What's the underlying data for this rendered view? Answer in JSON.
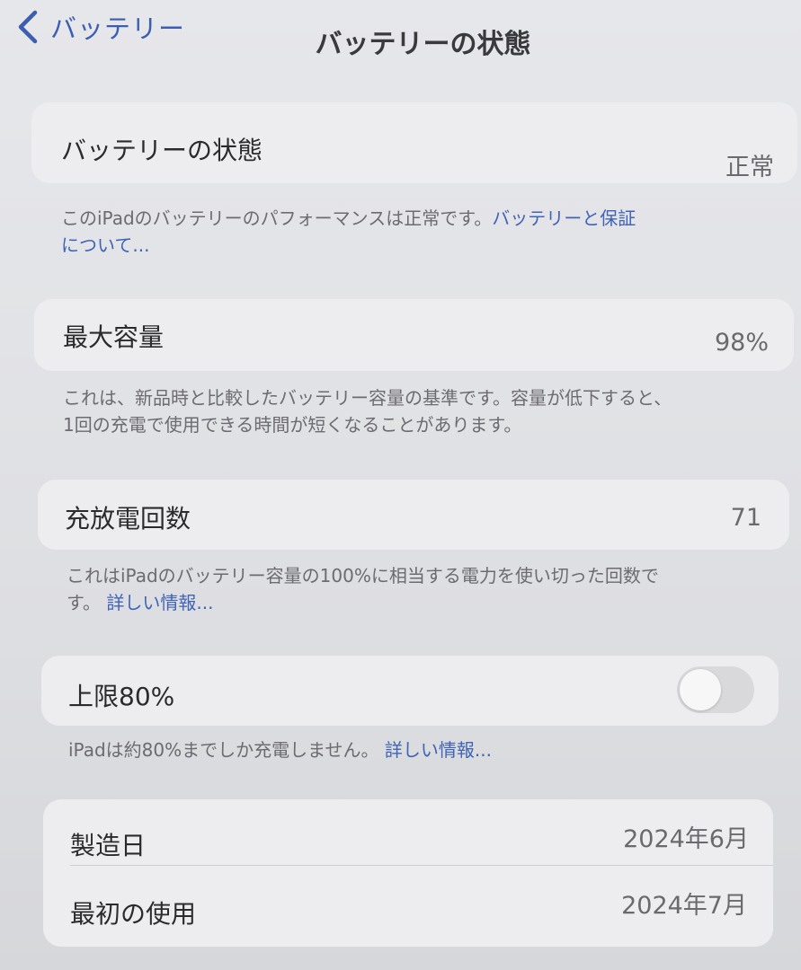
{
  "nav": {
    "back_label": "バッテリー",
    "title": "バッテリーの状態"
  },
  "health": {
    "label": "バッテリーの状態",
    "value": "正常",
    "footnote_text": "このiPadのバッテリーのパフォーマンスは正常です。",
    "footnote_link_part1": "バッテリーと保証",
    "footnote_link_part2": "について..."
  },
  "max_capacity": {
    "label": "最大容量",
    "value": "98%",
    "footnote_line1": "これは、新品時と比較したバッテリー容量の基準です。容量が低下すると、",
    "footnote_line2": "1回の充電で使用できる時間が短くなることがあります。"
  },
  "cycle_count": {
    "label": "充放電回数",
    "value": "71",
    "footnote_line1": "これはiPadのバッテリー容量の100%に相当する電力を使い切った回数で",
    "footnote_line2": "す。",
    "footnote_link": "詳しい情報..."
  },
  "limit": {
    "label": "上限80%",
    "toggle_on": false,
    "footnote_text": "iPadは約80%までしか充電しません。",
    "footnote_link": "詳しい情報..."
  },
  "info": {
    "manufacture_label": "製造日",
    "manufacture_value": "2024年6月",
    "first_use_label": "最初の使用",
    "first_use_value": "2024年7月"
  }
}
